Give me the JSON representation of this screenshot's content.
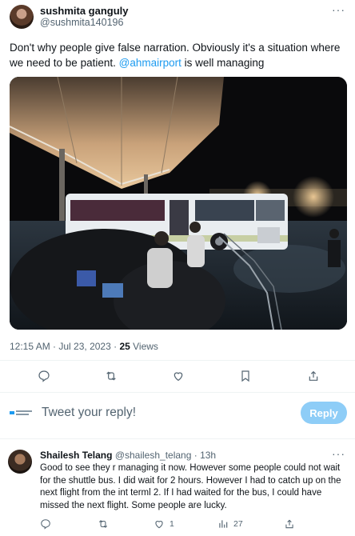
{
  "tweet": {
    "author": {
      "display_name": "sushmita ganguly",
      "handle": "@sushmita140196"
    },
    "more_label": "···",
    "text_before": "Don't why people give false narration. Obviously it's a situation where we need to be patient. ",
    "mention": "@ahmairport",
    "text_after": " is well managing",
    "media": {
      "icon": "photo",
      "description_colors": {
        "canopy": "#d9b48c",
        "bus": "#e9edf0",
        "water": "#202a33",
        "sky": "#0a0a0c"
      }
    },
    "meta": {
      "time": "12:15 AM",
      "separator": " · ",
      "date": "Jul 23, 2023",
      "views_count": "25",
      "views_label": " Views"
    },
    "actions": [
      "reply-icon",
      "retweet-icon",
      "like-icon",
      "bookmark-icon",
      "share-icon"
    ]
  },
  "composer": {
    "placeholder": "Tweet your reply!",
    "button_label": "Reply"
  },
  "reply": {
    "display_name": "Shailesh Telang",
    "handle": "@shailesh_telang",
    "separator": " · ",
    "time": "13h",
    "more_label": "···",
    "text": "Good to see they r managing it now. However some people could not wait for the shuttle bus. I did wait for 2 hours. However I had to catch up on the next flight from the int terml 2. If I had waited for the bus, I could have missed the next flight. Some people are lucky.",
    "likes": "1",
    "views": "27"
  },
  "colors": {
    "accent": "#1d9bf0",
    "muted": "#536471",
    "reply_button": "#8ecdf7"
  }
}
